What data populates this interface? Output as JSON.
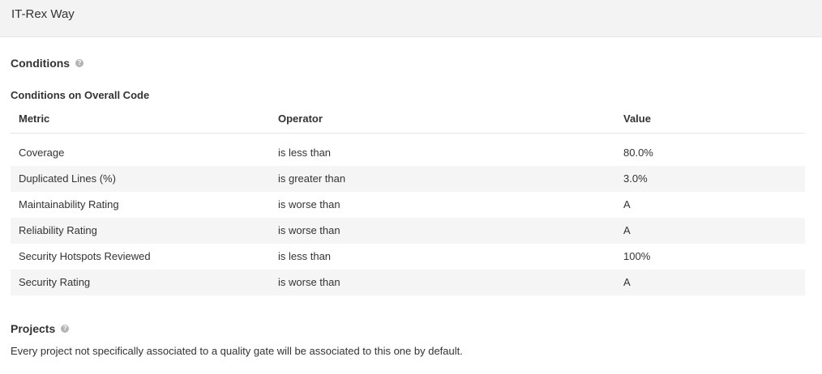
{
  "header": {
    "title": "IT-Rex Way"
  },
  "conditions": {
    "title": "Conditions",
    "help_icon": "help-icon",
    "overall_code": {
      "title": "Conditions on Overall Code",
      "columns": {
        "metric": "Metric",
        "operator": "Operator",
        "value": "Value"
      },
      "rows": [
        {
          "metric": "Coverage",
          "operator": "is less than",
          "value": "80.0%"
        },
        {
          "metric": "Duplicated Lines (%)",
          "operator": "is greater than",
          "value": "3.0%"
        },
        {
          "metric": "Maintainability Rating",
          "operator": "is worse than",
          "value": "A"
        },
        {
          "metric": "Reliability Rating",
          "operator": "is worse than",
          "value": "A"
        },
        {
          "metric": "Security Hotspots Reviewed",
          "operator": "is less than",
          "value": "100%"
        },
        {
          "metric": "Security Rating",
          "operator": "is worse than",
          "value": "A"
        }
      ]
    }
  },
  "projects": {
    "title": "Projects",
    "help_icon": "help-icon",
    "description": "Every project not specifically associated to a quality gate will be associated to this one by default."
  },
  "colors": {
    "header_bg": "#f3f3f3",
    "row_stripe": "#f5f5f5",
    "text": "#333333",
    "help_icon": "#b4b4b4"
  }
}
